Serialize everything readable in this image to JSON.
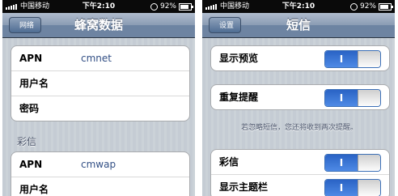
{
  "left": {
    "status": {
      "carrier": "中国移动",
      "time": "下午2:10",
      "battery": "92%"
    },
    "nav": {
      "back": "网络",
      "title": "蜂窝数据"
    },
    "cellular": {
      "rows": [
        {
          "label": "APN",
          "value": "cmnet"
        },
        {
          "label": "用户名",
          "value": ""
        },
        {
          "label": "密码",
          "value": ""
        }
      ]
    },
    "mms": {
      "header": "彩信",
      "rows": [
        {
          "label": "APN",
          "value": "cmwap"
        },
        {
          "label": "用户名",
          "value": ""
        }
      ]
    }
  },
  "right": {
    "status": {
      "carrier": "中国移动",
      "time": "下午2:10",
      "battery": "92%"
    },
    "nav": {
      "back": "设置",
      "title": "短信"
    },
    "switch_label": "I",
    "rows": {
      "show_preview": {
        "label": "显示预览",
        "on": true
      },
      "repeat_alert": {
        "label": "重复提醒",
        "on": true
      },
      "note": "若忽略短信，您还将收到两次提醒。",
      "mms": {
        "label": "彩信",
        "on": true
      },
      "show_subject": {
        "label": "显示主题栏",
        "on": true
      }
    }
  }
}
